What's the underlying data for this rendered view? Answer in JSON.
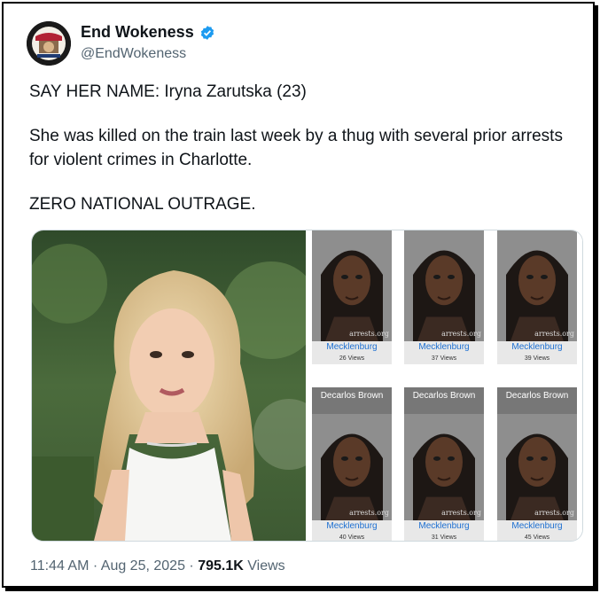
{
  "author": {
    "display_name": "End Wokeness",
    "handle": "@EndWokeness",
    "avatar_icon": "avatar-emblem-icon",
    "verified_icon": "verified-badge-icon",
    "verified_color": "#1d9bf0"
  },
  "tweet": {
    "lines": [
      "SAY HER NAME: Iryna Zarutska (23)",
      "She was killed on the train last week by a thug with several prior arrests for violent crimes in Charlotte.",
      "ZERO NATIONAL OUTRAGE."
    ]
  },
  "media": {
    "mugshots": [
      {
        "top_label": "",
        "county": "Mecklenburg",
        "views": "26 Views",
        "watermark": "arrests.org"
      },
      {
        "top_label": "",
        "county": "Mecklenburg",
        "views": "37 Views",
        "watermark": "arrests.org"
      },
      {
        "top_label": "",
        "county": "Mecklenburg",
        "views": "39 Views",
        "watermark": "arrests.org"
      },
      {
        "top_label": "Decarlos Brown",
        "county": "Mecklenburg",
        "views": "40 Views",
        "watermark": "arrests.org"
      },
      {
        "top_label": "Decarlos Brown",
        "county": "Mecklenburg",
        "views": "31 Views",
        "watermark": "arrests.org"
      },
      {
        "top_label": "Decarlos Brown",
        "county": "Mecklenburg",
        "views": "45 Views",
        "watermark": "arrests.org"
      }
    ]
  },
  "meta": {
    "time": "11:44 AM",
    "separator": "·",
    "date": "Aug 25, 2025",
    "views_count": "795.1K",
    "views_label": "Views"
  }
}
